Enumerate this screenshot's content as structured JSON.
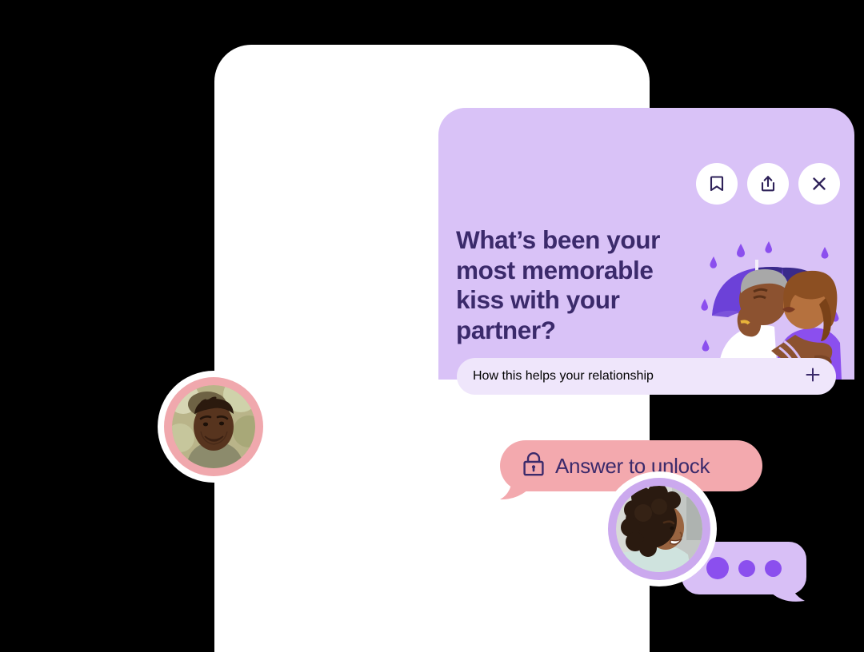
{
  "card": {
    "question": "What’s been your most memorable kiss with your partner?",
    "background_color": "#D9C2F7",
    "text_color": "#3B2A6B",
    "actions": [
      {
        "name": "bookmark",
        "label": "Bookmark",
        "icon": "bookmark-icon"
      },
      {
        "name": "share",
        "label": "Share",
        "icon": "share-icon"
      },
      {
        "name": "close",
        "label": "Close",
        "icon": "close-icon"
      }
    ],
    "illustration": {
      "name": "couple-kissing-under-umbrella-illustration",
      "description": "Couple kissing under a purple umbrella in the rain"
    }
  },
  "accordion": {
    "label": "How this helps your relationship",
    "expand_icon": "plus-icon",
    "background_color": "#EFE6FB",
    "text_color": "#3B2A6B"
  },
  "messages": {
    "unlock": {
      "label": "Answer to unlock",
      "icon": "lock-icon",
      "bubble_color": "#F3A9AE",
      "text_color": "#3B2A6B"
    },
    "typing": {
      "label": "Typing",
      "bubble_color": "#D8BFF6",
      "dot_color": "#8B4FEE",
      "dot_count": 3
    }
  },
  "avatars": {
    "left": {
      "name": "partner-avatar-left",
      "alt": "Smiling man outdoors",
      "ring_color": "#F0A8AD"
    },
    "right": {
      "name": "partner-avatar-right",
      "alt": "Smiling woman with curly hair",
      "ring_color": "#CBA9EE"
    }
  }
}
